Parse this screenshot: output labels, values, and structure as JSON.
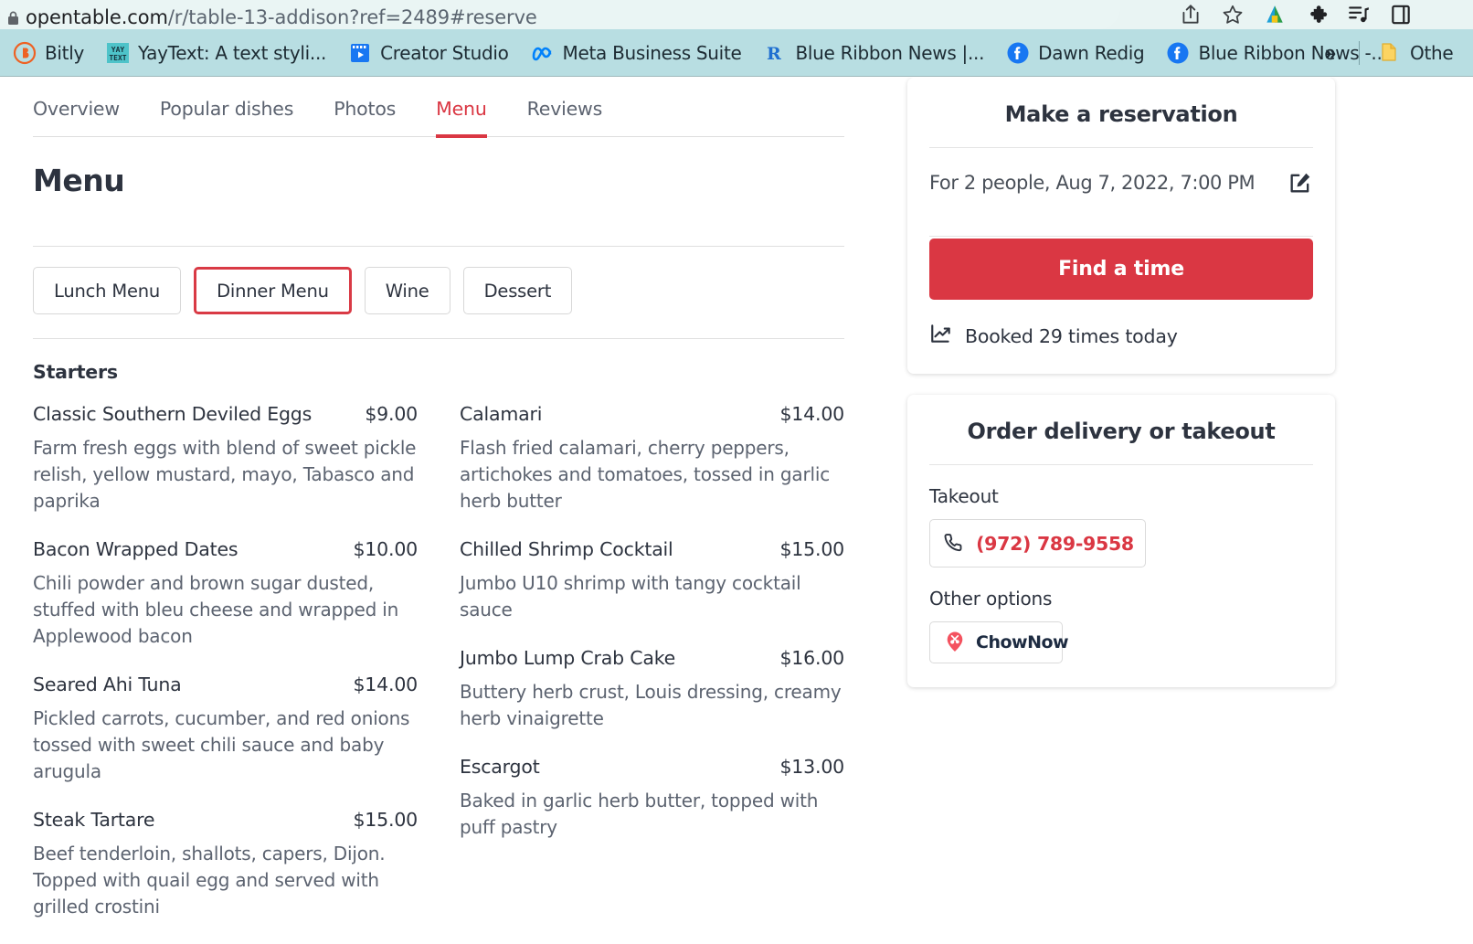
{
  "browser": {
    "url_scheme_host": "opentable.com",
    "url_path": "/r/table-13-addison?ref=2489#reserve",
    "lock_icon": "lock-icon",
    "omnibox_actions": [
      {
        "name": "share-icon",
        "label": "Share"
      },
      {
        "name": "bookmark-star-icon",
        "label": "Bookmark this tab"
      },
      {
        "name": "extension-colored-icon",
        "label": "Extension"
      },
      {
        "name": "extensions-puzzle-icon",
        "label": "Extensions"
      },
      {
        "name": "reading-list-icon",
        "label": "Reading list"
      },
      {
        "name": "sidepanel-icon",
        "label": "Side panel"
      }
    ],
    "bookmarks": [
      {
        "label": "Bitly",
        "icon": "bitly-icon"
      },
      {
        "label": "YayText: A text styli...",
        "icon": "yaytext-icon"
      },
      {
        "label": "Creator Studio",
        "icon": "creator-studio-icon"
      },
      {
        "label": "Meta Business Suite",
        "icon": "meta-icon"
      },
      {
        "label": "Blue Ribbon News |...",
        "icon": "blue-ribbon-icon"
      },
      {
        "label": "Dawn Redig",
        "icon": "facebook-icon"
      },
      {
        "label": "Blue Ribbon News -...",
        "icon": "facebook-icon"
      }
    ],
    "bookmarks_overflow": "»",
    "other_bookmarks_label": "Othe",
    "other_bookmarks_icon": "folder-icon"
  },
  "nav": {
    "tabs": [
      {
        "label": "Overview",
        "active": false
      },
      {
        "label": "Popular dishes",
        "active": false
      },
      {
        "label": "Photos",
        "active": false
      },
      {
        "label": "Menu",
        "active": true
      },
      {
        "label": "Reviews",
        "active": false
      }
    ]
  },
  "main": {
    "page_title": "Menu",
    "menu_types": [
      {
        "label": "Lunch Menu",
        "selected": false
      },
      {
        "label": "Dinner Menu",
        "selected": true
      },
      {
        "label": "Wine",
        "selected": false
      },
      {
        "label": "Dessert",
        "selected": false
      }
    ],
    "section_title": "Starters",
    "dishes_left": [
      {
        "name": "Classic Southern Deviled Eggs",
        "price": "$9.00",
        "desc": "Farm fresh eggs with blend of sweet pickle relish, yellow mustard, mayo, Tabasco and paprika"
      },
      {
        "name": "Bacon Wrapped Dates",
        "price": "$10.00",
        "desc": "Chili powder and brown sugar dusted, stuffed with bleu cheese and wrapped in Applewood bacon"
      },
      {
        "name": "Seared Ahi Tuna",
        "price": "$14.00",
        "desc": "Pickled carrots, cucumber, and red onions tossed with sweet chili sauce and baby arugula"
      },
      {
        "name": "Steak Tartare",
        "price": "$15.00",
        "desc": "Beef tenderloin, shallots, capers, Dijon. Topped with quail egg and served with grilled crostini"
      }
    ],
    "dishes_right": [
      {
        "name": "Calamari",
        "price": "$14.00",
        "desc": "Flash fried calamari, cherry peppers, artichokes and tomatoes, tossed in garlic herb butter"
      },
      {
        "name": "Chilled Shrimp Cocktail",
        "price": "$15.00",
        "desc": "Jumbo U10 shrimp with tangy cocktail sauce"
      },
      {
        "name": "Jumbo Lump Crab Cake",
        "price": "$16.00",
        "desc": "Buttery herb crust, Louis dressing, creamy herb vinaigrette"
      },
      {
        "name": "Escargot",
        "price": "$13.00",
        "desc": "Baked in garlic herb butter, topped with puff pastry"
      }
    ]
  },
  "reservation_card": {
    "title": "Make a reservation",
    "summary": "For 2 people, Aug 7, 2022, 7:00 PM",
    "edit_icon": "edit-pencil-icon",
    "cta_label": "Find a time",
    "booked_icon": "trending-up-icon",
    "booked_text": "Booked 29 times today"
  },
  "takeout_card": {
    "title": "Order delivery or takeout",
    "takeout_label": "Takeout",
    "phone_icon": "phone-icon",
    "phone_number": "(972) 789-9558",
    "other_options_label": "Other options",
    "chownow_label": "ChowNow",
    "chownow_icon": "chownow-pin-icon"
  },
  "colors": {
    "brand_red": "#da3743",
    "text_dark": "#2d333f",
    "text_muted": "#5c6370",
    "bookmark_bar": "#b8dee2",
    "omnibox_bg": "#eaf5f4"
  }
}
